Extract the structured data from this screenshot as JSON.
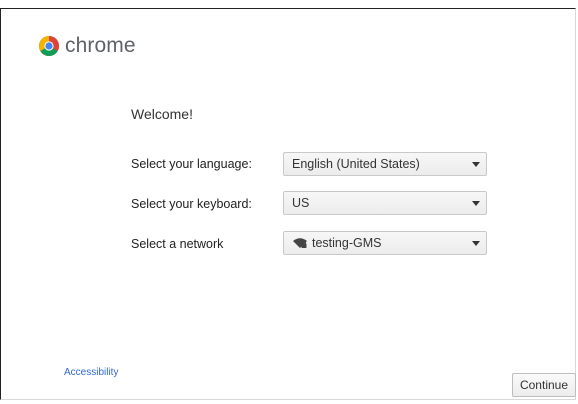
{
  "brand": {
    "name": "chrome",
    "logo_icon": "chrome-logo-icon",
    "colors": {
      "red": "#db4437",
      "green": "#0f9d58",
      "yellow": "#f4b400",
      "blue": "#4285f4"
    }
  },
  "welcome": {
    "heading": "Welcome!"
  },
  "form": {
    "language": {
      "label": "Select your language:",
      "value": "English (United States)"
    },
    "keyboard": {
      "label": "Select your keyboard:",
      "value": "US"
    },
    "network": {
      "label": "Select a network",
      "value": "testing-GMS",
      "icon": "wifi-locked-icon"
    }
  },
  "footer": {
    "accessibility_link": "Accessibility",
    "continue_label": "Continue"
  },
  "colors": {
    "link": "#3367d6"
  }
}
